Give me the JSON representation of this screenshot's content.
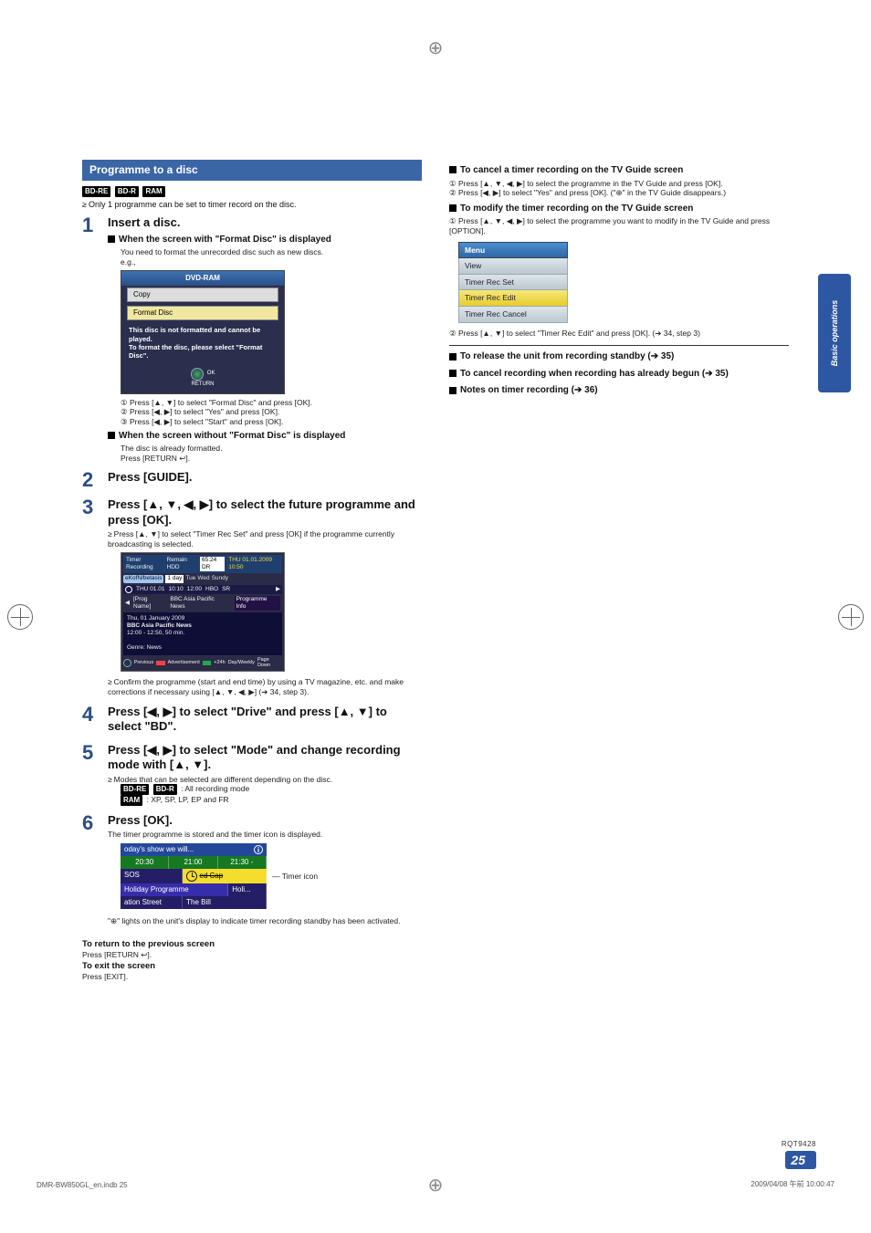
{
  "side_tab": "Basic operations",
  "section_title": "Programme to a disc",
  "media_badges": [
    "BD-RE",
    "BD-R",
    "RAM"
  ],
  "note_single_prog": "Only 1 programme can be set to timer record on the disc.",
  "steps": {
    "s1": {
      "title": "Insert a disc.",
      "sub1_h": "When the screen with \"Format Disc\" is displayed",
      "sub1_p": "You need to format the unrecorded disc such as new discs.",
      "eg": "e.g.,",
      "dvd_title": "DVD-RAM",
      "dvd_copy": "Copy",
      "dvd_format": "Format Disc",
      "dvd_msg1": "This disc is not formatted and cannot be played.",
      "dvd_msg2": "To format the disc, please select \"Format Disc\".",
      "dvd_ok": "OK",
      "dvd_return": "RETURN",
      "line1": "① Press [▲, ▼] to select \"Format Disc\" and press [OK].",
      "line2": "② Press [◀, ▶] to select \"Yes\" and press [OK].",
      "line3": "③ Press [◀, ▶] to select \"Start\" and press [OK].",
      "sub2_h": "When the screen without \"Format Disc\" is displayed",
      "sub2_p1": "The disc is already formatted.",
      "sub2_p2": "Press [RETURN ↩]."
    },
    "s2": {
      "title": "Press [GUIDE]."
    },
    "s3": {
      "title": "Press [▲, ▼, ◀, ▶] to select the future programme and press [OK].",
      "note": "Press [▲, ▼] to select \"Timer Rec Set\" and press [OK] if the programme currently broadcasting is selected.",
      "guide_timer_recording": "Timer Recording",
      "guide_remain": "Remain HDD",
      "guide_remain_val": "65:24 DR",
      "guide_date": "THU 01.01.2009 10:50",
      "guide_profile": "eKofN/betasis",
      "guide_tab": "1 day",
      "guide_tab2": "Tue",
      "guide_tab3": "Wed",
      "guide_tab4": "Sundy",
      "guide_row_date": "THU 01.01",
      "guide_row_t1": "10:10",
      "guide_row_t2": "12:00",
      "guide_row_t3": "HBO",
      "guide_row_t4": "SR",
      "guide_prog_name": "[Prog Name]",
      "guide_bbc": "BBC Asia Pacific News",
      "guide_prog_info": "Programme Info",
      "guide_detail_date": "Thu, 01 January 2009",
      "guide_detail_title": "BBC Asia Pacific News",
      "guide_detail_time": "12:00 - 12:50, 50 min.",
      "guide_genre": "Genre: News",
      "guide_leg_prev": "Previous",
      "guide_leg_adv": "Advertisement",
      "guide_leg_jmp": "+24h",
      "guide_leg_day": "Day/Weekly",
      "guide_leg_pd": "Page Down",
      "confirm_note": "Confirm the programme (start and end time) by using a TV magazine, etc. and make corrections if necessary using [▲, ▼, ◀, ▶] (➔ 34, step 3)."
    },
    "s4": {
      "title": "Press [◀, ▶] to select \"Drive\" and press [▲, ▼] to select \"BD\"."
    },
    "s5": {
      "title": "Press [◀, ▶] to select \"Mode\" and change recording mode with [▲, ▼].",
      "note": "Modes that can be selected are different depending on the disc.",
      "badge_line1": ": All recording mode",
      "badge_line2": ": XP, SP, LP, EP and FR"
    },
    "s6": {
      "title": "Press [OK].",
      "p": "The timer programme is stored and the timer icon is displayed.",
      "sched_head": "oday's show we will...",
      "t1": "20:30",
      "t2": "21:00",
      "t3": "21:30 -",
      "r1a": "SOS",
      "r1b": "ed Cap",
      "r2a": "Holiday Programme",
      "r2b": "Holi...",
      "r3a": "ation Street",
      "r3b": "The Bill",
      "timer_label": "Timer icon",
      "foot_note": "\"⊕\" lights on the unit's display to indicate timer recording standby has been activated."
    }
  },
  "return_prev_h": "To return to the previous screen",
  "return_prev_p": "Press [RETURN ↩].",
  "exit_h": "To exit the screen",
  "exit_p": "Press [EXIT].",
  "right": {
    "h1": "To cancel a timer recording on the TV Guide screen",
    "l1": "① Press [▲, ▼, ◀, ▶] to select the programme in the TV Guide and press [OK].",
    "l2": "② Press [◀, ▶] to select \"Yes\" and press [OK]. (\"⊕\" in the TV Guide disappears.)",
    "h2": "To modify the timer recording on the TV Guide screen",
    "l3": "① Press [▲, ▼, ◀, ▶] to select the programme you want to modify in the TV Guide and press [OPTION].",
    "menu_hdr": "Menu",
    "menu_items": [
      "View",
      "Timer Rec Set",
      "Timer Rec Edit",
      "Timer Rec Cancel"
    ],
    "l4": "② Press [▲, ▼] to select \"Timer Rec Edit\" and press [OK]. (➔ 34, step 3)",
    "h3": "To release the unit from recording standby (➔ 35)",
    "h4": "To cancel recording when recording has already begun (➔ 35)",
    "h5": "Notes on timer recording (➔ 36)"
  },
  "page_code": "RQT9428",
  "page_num": "25",
  "foot_left": "DMR-BW850GL_en.indb   25",
  "foot_right": "2009/04/08   午前 10:00:47"
}
